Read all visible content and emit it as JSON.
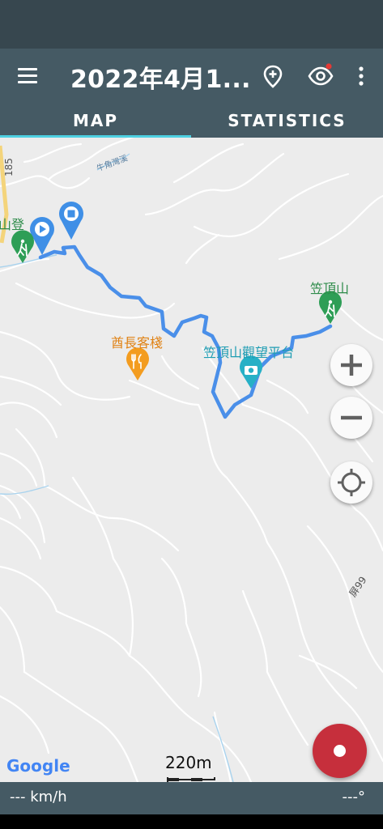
{
  "app_bar": {
    "title": "2022年4月1...",
    "menu_icon": "hamburger-menu-icon",
    "marker_icon": "add-marker-icon",
    "visibility_icon": "eye-icon",
    "overflow_icon": "more-vert-icon",
    "notification_dot_color": "#e53935"
  },
  "tabs": [
    {
      "label": "MAP",
      "selected": true
    },
    {
      "label": "STATISTICS",
      "selected": false
    }
  ],
  "map": {
    "labels": {
      "road_185": "185",
      "stream": "牛角灣溪",
      "trailhead": "山登",
      "peak": "笠頂山",
      "restaurant": "酋長客棧",
      "viewpoint": "笠頂山觀望平台",
      "road_99": "屏99"
    },
    "scale_label": "220m",
    "google_logo": "Google",
    "track_color": "#4a8fe9",
    "poi_green": "#2e9e56",
    "poi_orange": "#f39c1f",
    "poi_teal": "#26b0c6"
  },
  "controls": {
    "zoom_in_icon": "plus-icon",
    "zoom_out_icon": "minus-icon",
    "my_location_icon": "my-location-icon",
    "record_icon": "record-icon"
  },
  "bottom": {
    "speed": "--- km/h",
    "bearing": "---°"
  }
}
